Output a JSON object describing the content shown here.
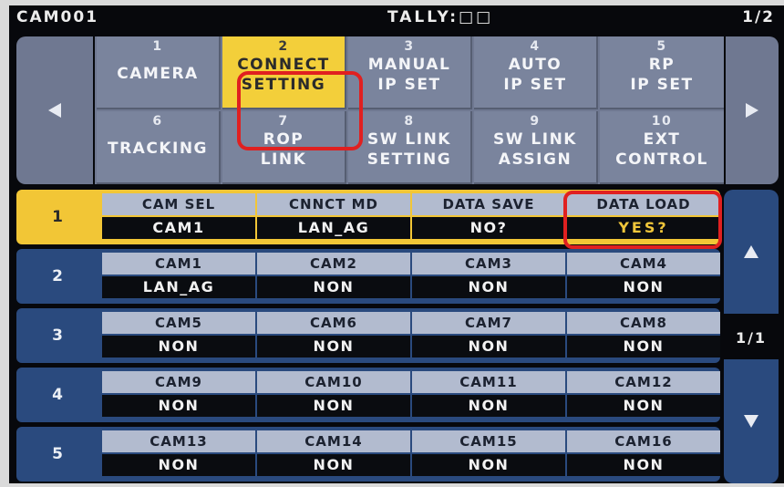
{
  "header": {
    "camera": "CAM001",
    "tally": "TALLY:□□",
    "page": "1/2"
  },
  "menu": {
    "prev_icon": "left-arrow-icon",
    "next_icon": "right-arrow-icon",
    "items": [
      {
        "num": "1",
        "line1": "CAMERA",
        "line2": "",
        "selected": false
      },
      {
        "num": "2",
        "line1": "CONNECT",
        "line2": "SETTING",
        "selected": true
      },
      {
        "num": "3",
        "line1": "MANUAL",
        "line2": "IP SET",
        "selected": false
      },
      {
        "num": "4",
        "line1": "AUTO",
        "line2": "IP SET",
        "selected": false
      },
      {
        "num": "5",
        "line1": "RP",
        "line2": "IP SET",
        "selected": false
      },
      {
        "num": "6",
        "line1": "TRACKING",
        "line2": "",
        "selected": false
      },
      {
        "num": "7",
        "line1": "ROP",
        "line2": "LINK",
        "selected": false
      },
      {
        "num": "8",
        "line1": "SW LINK",
        "line2": "SETTING",
        "selected": false
      },
      {
        "num": "9",
        "line1": "SW LINK",
        "line2": "ASSIGN",
        "selected": false
      },
      {
        "num": "10",
        "line1": "EXT",
        "line2": "CONTROL",
        "selected": false
      }
    ]
  },
  "rows": [
    {
      "num": "1",
      "active": true,
      "cells": [
        {
          "label": "CAM SEL",
          "value": "CAM1"
        },
        {
          "label": "CNNCT MD",
          "value": "LAN_AG"
        },
        {
          "label": "DATA SAVE",
          "value": "NO?"
        },
        {
          "label": "DATA LOAD",
          "value": "YES?"
        }
      ]
    },
    {
      "num": "2",
      "active": false,
      "cells": [
        {
          "label": "CAM1",
          "value": "LAN_AG"
        },
        {
          "label": "CAM2",
          "value": "NON"
        },
        {
          "label": "CAM3",
          "value": "NON"
        },
        {
          "label": "CAM4",
          "value": "NON"
        }
      ]
    },
    {
      "num": "3",
      "active": false,
      "cells": [
        {
          "label": "CAM5",
          "value": "NON"
        },
        {
          "label": "CAM6",
          "value": "NON"
        },
        {
          "label": "CAM7",
          "value": "NON"
        },
        {
          "label": "CAM8",
          "value": "NON"
        }
      ]
    },
    {
      "num": "4",
      "active": false,
      "cells": [
        {
          "label": "CAM9",
          "value": "NON"
        },
        {
          "label": "CAM10",
          "value": "NON"
        },
        {
          "label": "CAM11",
          "value": "NON"
        },
        {
          "label": "CAM12",
          "value": "NON"
        }
      ]
    },
    {
      "num": "5",
      "active": false,
      "cells": [
        {
          "label": "CAM13",
          "value": "NON"
        },
        {
          "label": "CAM14",
          "value": "NON"
        },
        {
          "label": "CAM15",
          "value": "NON"
        },
        {
          "label": "CAM16",
          "value": "NON"
        }
      ]
    }
  ],
  "scroll": {
    "up_icon": "up-arrow-icon",
    "page": "1/1",
    "down_icon": "down-arrow-icon"
  },
  "colors": {
    "accent": "#f2c636",
    "highlight_ring": "#e02020",
    "row_bg": "#2a4a7e",
    "menu_bg": "#7a849d"
  }
}
